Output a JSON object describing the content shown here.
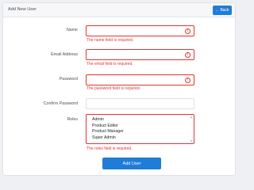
{
  "header": {
    "title": "Add New User",
    "back_label": "Back",
    "back_icon": "arrow-left-icon"
  },
  "form": {
    "name": {
      "label": "Name",
      "value": "",
      "error": "The name field is required."
    },
    "email": {
      "label": "Email Address",
      "value": "",
      "error": "The email field is required."
    },
    "password": {
      "label": "Password",
      "value": "",
      "error": "The password field is required."
    },
    "confirm_password": {
      "label": "Confirm Password",
      "value": ""
    },
    "roles": {
      "label": "Roles",
      "options": [
        "Admin",
        "Product Editor",
        "Product Manager",
        "Super Admin"
      ],
      "error": "The roles field is required."
    },
    "submit_label": "Add User",
    "error_icon_glyph": "!"
  },
  "colors": {
    "primary": "#1f7dd8",
    "error": "#e3342f",
    "header_bg": "#f7f7f9",
    "page_bg": "#eef0f3"
  }
}
